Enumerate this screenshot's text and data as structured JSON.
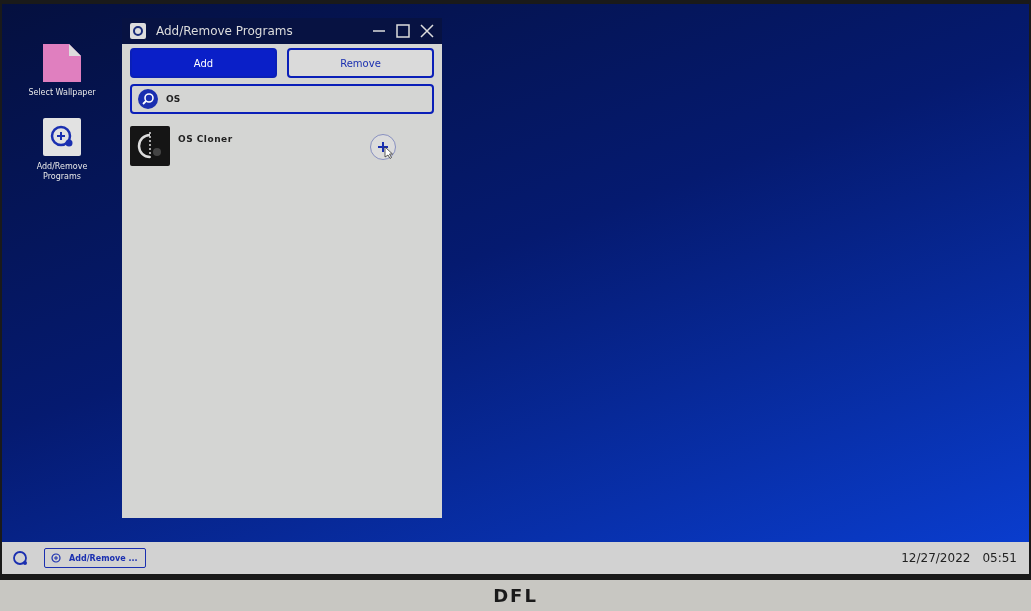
{
  "desktop_icons": [
    {
      "kind": "wallpaper",
      "label": "Select Wallpaper"
    },
    {
      "kind": "programs",
      "label": "Add/Remove Programs"
    }
  ],
  "window": {
    "title": "Add/Remove Programs"
  },
  "tabs": [
    {
      "label": "Add",
      "selected": true
    },
    {
      "label": "Remove",
      "selected": false
    }
  ],
  "search": {
    "value": "OS"
  },
  "programs": [
    {
      "name": "OS Cloner"
    }
  ],
  "taskbar": {
    "items": [
      {
        "label": "Add/Remove ...",
        "selected": true
      }
    ],
    "date": "12/27/2022",
    "time": "05:51"
  },
  "monitor": {
    "brand": "DFL"
  }
}
